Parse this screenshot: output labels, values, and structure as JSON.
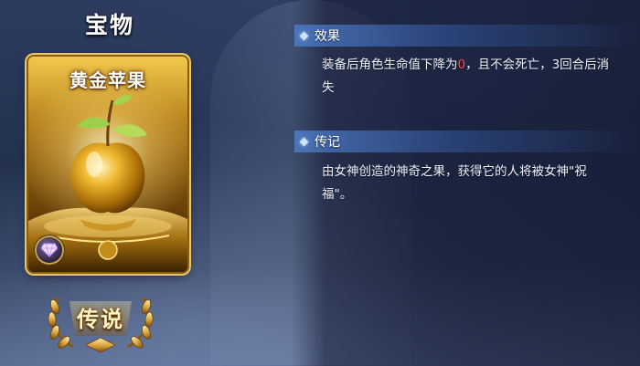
{
  "page_title": "宝物",
  "item": {
    "name": "黄金苹果",
    "rarity": "传说"
  },
  "effect": {
    "title": "效果",
    "text_before": "装备后角色生命值下降为",
    "highlight_value": "0",
    "text_after": "，且不会死亡，3回合后消失"
  },
  "lore": {
    "title": "传记",
    "text": "由女神创造的神奇之果，获得它的人将被女神\"祝福\"。"
  },
  "colors": {
    "highlight": "#ff4a4a",
    "section_bar": "#4f82d2",
    "card_gold": "#e9c668"
  },
  "icons": {
    "rarity_gem": "diamond-icon",
    "section_marker": "diamond-marker-icon",
    "laurel": "laurel-wreath-icon"
  }
}
